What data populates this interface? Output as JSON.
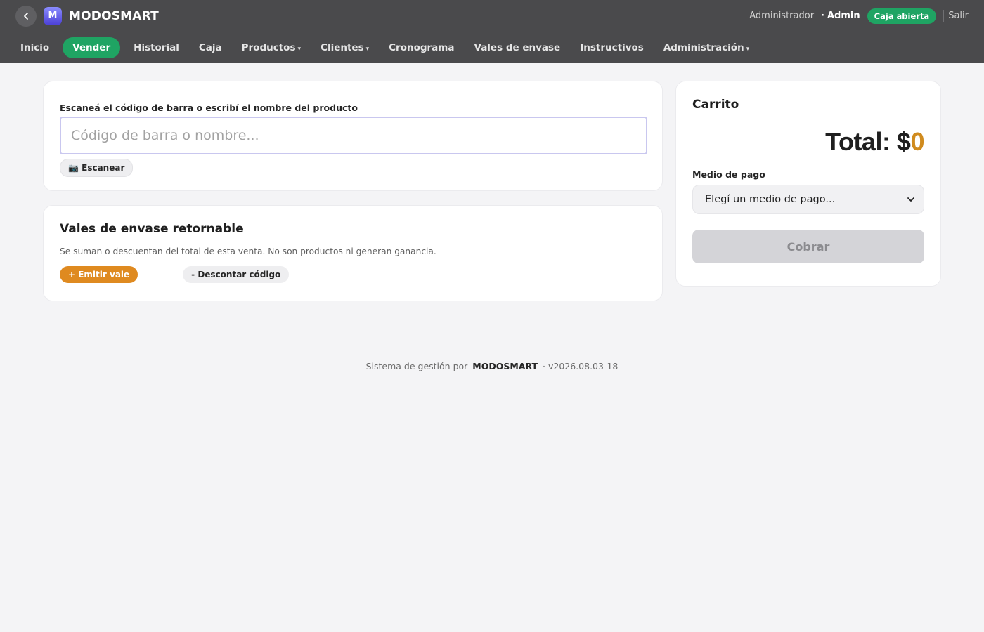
{
  "header": {
    "brand": "MODOSMART",
    "logo_letter": "M",
    "role": "Administrador",
    "separator": "·",
    "user": "Admin",
    "status_badge": "Caja abierta",
    "logout": "Salir"
  },
  "nav": {
    "items": [
      {
        "label": "Inicio",
        "dropdown": false,
        "active": false
      },
      {
        "label": "Vender",
        "dropdown": false,
        "active": true
      },
      {
        "label": "Historial",
        "dropdown": false,
        "active": false
      },
      {
        "label": "Caja",
        "dropdown": false,
        "active": false
      },
      {
        "label": "Productos",
        "dropdown": true,
        "active": false
      },
      {
        "label": "Clientes",
        "dropdown": true,
        "active": false
      },
      {
        "label": "Cronograma",
        "dropdown": false,
        "active": false
      },
      {
        "label": "Vales de envase",
        "dropdown": false,
        "active": false
      },
      {
        "label": "Instructivos",
        "dropdown": false,
        "active": false
      },
      {
        "label": "Administración",
        "dropdown": true,
        "active": false
      }
    ],
    "caret": "▾"
  },
  "scan": {
    "label": "Escaneá el código de barra o escribí el nombre del producto",
    "placeholder": "Código de barra o nombre...",
    "scan_button": "📷 Escanear"
  },
  "vales": {
    "title": "Vales de envase retornable",
    "description": "Se suman o descuentan del total de esta venta. No son productos ni generan ganancia.",
    "emit_button": "+ Emitir vale",
    "discount_button": "- Descontar código"
  },
  "cart": {
    "title": "Carrito",
    "total_label": "Total: $",
    "total_value": "0",
    "payment_label": "Medio de pago",
    "payment_selected": "Elegí un medio de pago...",
    "charge_button": "Cobrar"
  },
  "footer": {
    "prefix": "Sistema de gestión por",
    "brand": "MODOSMART",
    "version": "· v2026.08.03-18"
  },
  "colors": {
    "header_bg": "#4a4a4c",
    "accent_green": "#1fa463",
    "accent_orange": "#df8a20",
    "total_value": "#d08b1e",
    "page_bg": "#f4f4f6"
  }
}
